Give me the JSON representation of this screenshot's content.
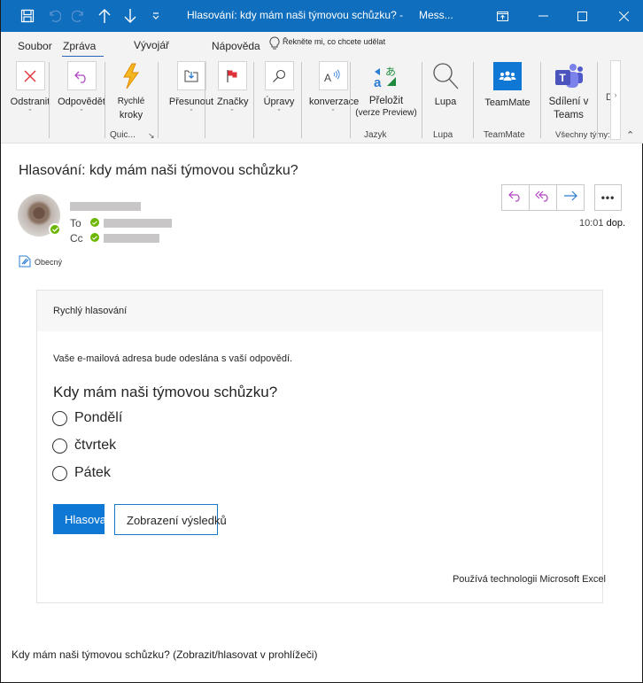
{
  "window": {
    "title": "Hlasování: kdy mám naši týmovou schůzku? -",
    "app": "Mess...",
    "quick_access": [
      "save-icon",
      "undo-icon",
      "redo-icon",
      "up-arrow-icon",
      "down-arrow-icon",
      "customize-qat-icon"
    ],
    "controls": [
      "ribbon-display-icon",
      "minimize-icon",
      "maximize-icon",
      "close-icon"
    ]
  },
  "tabs": [
    {
      "label": "Soubor"
    },
    {
      "label": "Zpráva",
      "active": true
    },
    {
      "label": "Vývojář"
    },
    {
      "label": "Nápověda"
    }
  ],
  "tell_me": "Řekněte mi, co chcete udělat",
  "ribbon": {
    "buttons": [
      {
        "label": "Odstranit",
        "icon": "delete-icon"
      },
      {
        "label": "Odpovědět",
        "icon": "reply-icon"
      },
      {
        "label": "Rychlé",
        "label2": "kroky",
        "icon": "lightning-icon"
      },
      {
        "label": "Přesunout",
        "icon": "move-icon"
      },
      {
        "label": "Značky",
        "icon": "flag-icon"
      },
      {
        "label": "Úpravy",
        "icon": "search-icon"
      },
      {
        "label": "konverzace",
        "icon": "read-aloud-icon"
      },
      {
        "label": "Přeložit",
        "label2": "(verze Preview)",
        "icon": "translate-icon"
      },
      {
        "label": "Lupa",
        "icon": "zoom-icon"
      },
      {
        "label": "TeamMate",
        "icon": "teammate-icon"
      },
      {
        "label": "Sdílení v",
        "label2": "Teams",
        "icon": "teams-icon"
      }
    ],
    "groups": {
      "quick": "Quic...",
      "language": "Jazyk",
      "zoom": "Lupa",
      "teammate": "TeamMate",
      "teams": "Všechny týmy:"
    },
    "overflow_label": "D"
  },
  "message": {
    "subject": "Hlasování: kdy mám naši týmovou schůzku?",
    "to_label": "To",
    "cc_label": "Cc",
    "time": "10:01",
    "ampm": "dop.",
    "sensitivity": "Obecný",
    "actions": [
      "reply",
      "reply-all",
      "forward",
      "more"
    ]
  },
  "poll": {
    "header": "Rychlý hlasování",
    "note": "Vaše e-mailová adresa bude odeslána s vaší odpovědí.",
    "question": "Kdy mám naši týmovou schůzku?",
    "options": [
      "Pondělí",
      "čtvrtek",
      "Pátek"
    ],
    "vote_button": "Hlasovat",
    "results_button": "Zobrazení výsledků",
    "powered_by": "Používá technologii Microsoft Excel"
  },
  "footer_link": "Kdy mám naši týmovou schůzku? (Zobrazit/hlasovat v prohlížeči)"
}
